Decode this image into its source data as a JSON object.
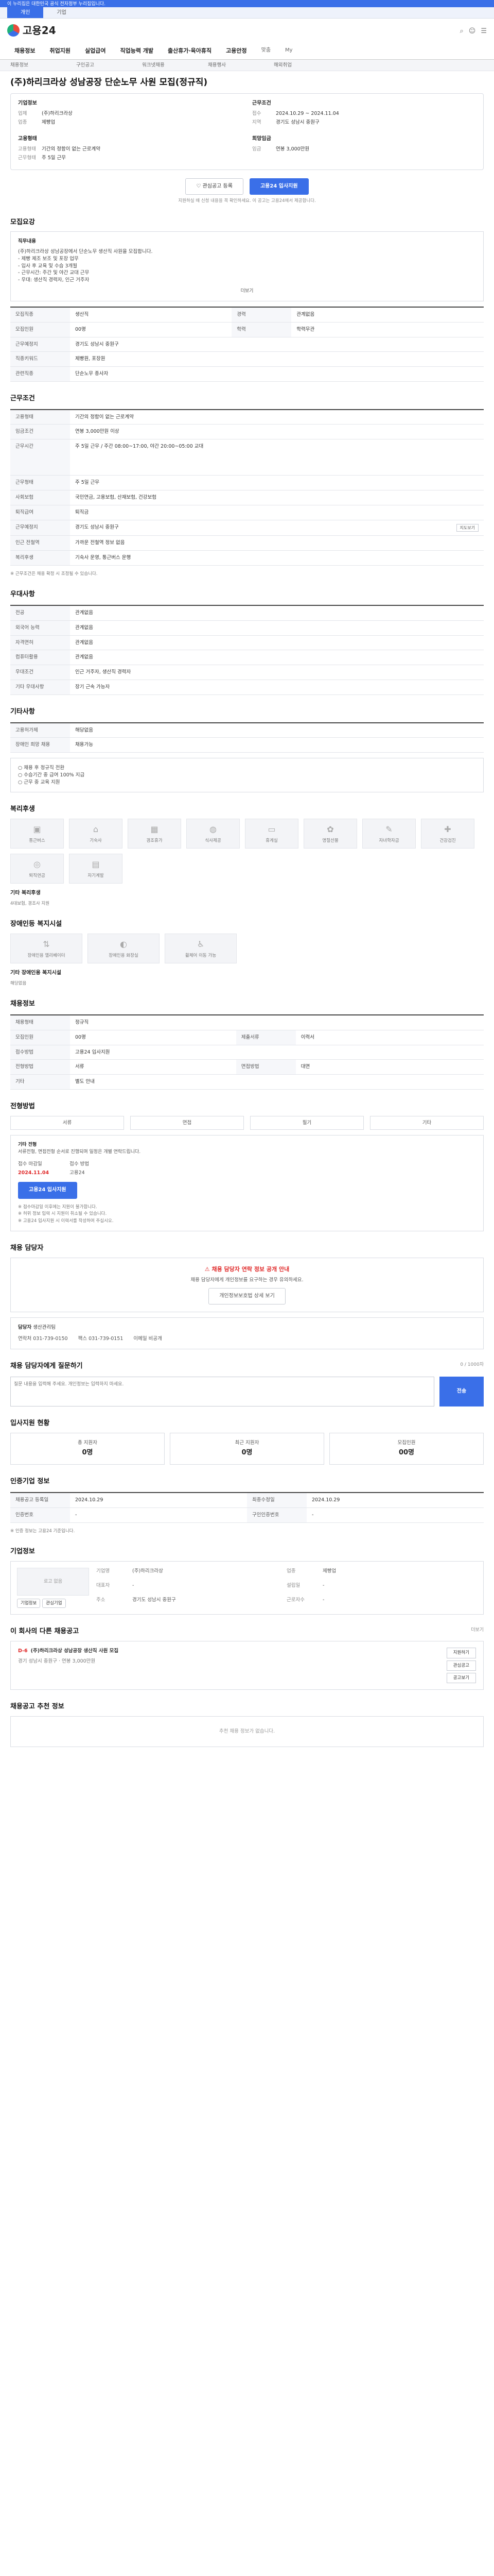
{
  "top": {
    "gov": "이 누리집은 대한민국 공식 전자정부 누리집입니다.",
    "tabs": [
      "개인",
      "기업"
    ]
  },
  "header": {
    "logo": "고용24"
  },
  "gnb": [
    "채용정보",
    "취업지원",
    "실업급여",
    "직업능력 개발",
    "출산휴가·육아휴직",
    "고용안정",
    "맞춤",
    "My"
  ],
  "subnav": [
    "채용정보",
    "구인공고",
    "워크넷채용",
    "채용행사",
    "해외취업"
  ],
  "job": {
    "title": "(주)하리크라상 성남공장 단순노무 사원 모집(정규직)",
    "company_label": "기업정보",
    "company": [
      [
        "업체",
        "(주)하리크라상"
      ],
      [
        "업종",
        "제빵업"
      ]
    ],
    "period_label": "근무조건",
    "period": [
      [
        "접수",
        "2024.10.29 ~ 2024.11.04"
      ],
      [
        "지역",
        "경기도 성남시 중원구"
      ]
    ],
    "emp_label": "고용형태",
    "emp": [
      [
        "고용형태",
        "기간의 정함이 없는 근로계약"
      ],
      [
        "근무형태",
        "주 5일 근무"
      ]
    ],
    "wage_label": "희망임금",
    "wage": [
      [
        "임금",
        "연봉 3,000만원"
      ]
    ],
    "btn_scrap": "관심공고 등록",
    "btn_apply": "고용24 입사지원",
    "note": "지원하실 때 신청 내용을 꼭 확인하세요. 이 공고는 고용24에서 제공합니다."
  },
  "s1": {
    "title": "모집요강",
    "desc_h": "직무내용",
    "desc": [
      "(주)하리크라상 성남공장에서 단순노무 생산직 사원을 모집합니다.",
      "- 제빵 제조 보조 및 포장 업무",
      "- 입사 후 교육 및 수습 3개월",
      "- 근무시간: 주간 및 야간 교대 근무",
      "- 우대: 생산직 경력자, 인근 거주자"
    ],
    "more": "더보기",
    "rows": [
      [
        "모집직종",
        "생산직",
        "경력",
        "관계없음"
      ],
      [
        "모집인원",
        "00명",
        "학력",
        "학력무관"
      ],
      [
        "근무예정지",
        "경기도 성남시 중원구",
        "",
        ""
      ],
      [
        "직종키워드",
        "제빵원, 포장원",
        "",
        ""
      ],
      [
        "관련직종",
        "단순노무 종사자",
        "",
        ""
      ]
    ]
  },
  "s2": {
    "title": "근무조건",
    "rows": [
      [
        "고용형태",
        "기간의 정함이 없는 근로계약"
      ],
      [
        "임금조건",
        "연봉 3,000만원 이상"
      ],
      [
        "근무시간",
        "주 5일 근무 / 주간 08:00~17:00, 야간 20:00~05:00 교대"
      ],
      [
        "근무형태",
        "주 5일 근무"
      ],
      [
        "사회보험",
        "국민연금, 고용보험, 산재보험, 건강보험"
      ],
      [
        "퇴직급여",
        "퇴직금"
      ],
      [
        "근무예정지",
        "경기도 성남시 중원구"
      ],
      [
        "인근 전철역",
        "가까운 전철역 정보 없음"
      ],
      [
        "복리후생",
        "기숙사 운영, 통근버스 운행"
      ]
    ],
    "map_btn": "지도보기",
    "note": "※ 근무조건은 채용 확정 시 조정될 수 있습니다."
  },
  "s3": {
    "title": "우대사항",
    "rows": [
      [
        "전공",
        "관계없음"
      ],
      [
        "외국어 능력",
        "관계없음"
      ],
      [
        "자격면허",
        "관계없음"
      ],
      [
        "컴퓨터활용",
        "관계없음"
      ],
      [
        "우대조건",
        "인근 거주자, 생산직 경력자"
      ],
      [
        "기타 우대사항",
        "장기 근속 가능자"
      ]
    ]
  },
  "s4": {
    "title": "기타사항",
    "rows": [
      [
        "고용허가제",
        "해당없음"
      ],
      [
        "장애인 희망 채용",
        "채용가능"
      ]
    ],
    "extra": [
      "○ 채용 후 정규직 전환",
      "○ 수습기간 중 급여 100% 지급",
      "○ 근무 중 교육 지원"
    ]
  },
  "s5": {
    "title": "복리후생",
    "items": [
      "통근버스",
      "기숙사",
      "경조휴가",
      "식사제공",
      "휴게실",
      "명절선물",
      "자녀학자금",
      "건강검진",
      "퇴직연금",
      "자기계발"
    ],
    "other_h": "기타 복리후생",
    "other": "4대보험, 경조사 지원"
  },
  "s6": {
    "title": "장애인등 복지시설",
    "items": [
      "장애인용 엘리베이터",
      "장애인용 화장실",
      "휠체어 이동 가능"
    ],
    "other_h": "기타 장애인용 복지시설",
    "other": "해당없음"
  },
  "s7": {
    "title": "채용정보",
    "rows": [
      [
        "채용형태",
        "정규직",
        "",
        ""
      ],
      [
        "모집인원",
        "00명",
        "제출서류",
        "이력서"
      ],
      [
        "접수방법",
        "고용24 입사지원",
        "",
        ""
      ],
      [
        "전형방법",
        "서류",
        "면접방법",
        "대면"
      ],
      [
        "기타",
        "별도 안내",
        "",
        ""
      ]
    ]
  },
  "s8": {
    "title": "전형방법",
    "methods": [
      "서류",
      "면접",
      "필기",
      "기타"
    ],
    "info_h": "기타 전형",
    "info": "서류전형, 면접전형 순서로 진행되며 일정은 개별 연락드립니다.",
    "app_h": "접수 마감일",
    "app_date": "2024.11.04",
    "reg_h": "접수 방법",
    "reg": "고용24",
    "btn": "고용24 입사지원",
    "bul": [
      "※ 접수마감일 이후에는 지원이 불가합니다.",
      "※ 허위 정보 입력 시 지원이 취소될 수 있습니다.",
      "※ 고용24 입사지원 시 이력서를 작성하여 주십시오."
    ]
  },
  "s9": {
    "title": "채용 담당자",
    "warn_t": "채용 담당자 연락 정보 공개 안내",
    "warn": "채용 담당자에게 개인정보를 요구하는 경우 유의하세요.",
    "btn": "개인정보보호법 상세 보기",
    "name_h": "담당자",
    "name": "생산관리팀",
    "tel_h": "연락처",
    "tel": "031-739-0150",
    "fax_h": "팩스",
    "fax": "031-739-0151",
    "email_h": "이메일",
    "email": "비공개"
  },
  "s10": {
    "title": "채용 담당자에게 질문하기",
    "ph": "질문 내용을 입력해 주세요. 개인정보는 입력하지 마세요.",
    "send": "전송",
    "count": "0 / 1000자"
  },
  "s11": {
    "title": "입사지원 현황",
    "items": [
      [
        "총 지원자",
        "0명"
      ],
      [
        "최근 지원자",
        "0명"
      ],
      [
        "모집인원",
        "00명"
      ]
    ]
  },
  "s12": {
    "title": "인증기업 정보",
    "rows": [
      [
        "채용공고 등록일",
        "2024.10.29",
        "최종수정일",
        "2024.10.29"
      ],
      [
        "인증번호",
        "-",
        "구인인증번호",
        "-"
      ]
    ],
    "note": "※ 인증 정보는 고용24 기준입니다."
  },
  "s13": {
    "title": "기업정보",
    "logo": "로고 없음",
    "rows": [
      [
        "기업명",
        "(주)하리크라상",
        "업종",
        "제빵업"
      ],
      [
        "대표자",
        "-",
        "설립일",
        "-"
      ],
      [
        "주소",
        "경기도 성남시 중원구",
        "근로자수",
        "-"
      ]
    ],
    "btn1": "기업정보",
    "btn2": "관심기업"
  },
  "s14": {
    "title": "이 회사의 다른 채용공고",
    "more": "더보기",
    "dday": "D-6",
    "job_title": "(주)하리크라상 성남공장 생산직 사원 모집",
    "job_info": "경기 성남시 중원구 · 연봉 3,000만원",
    "side": [
      "지원하기",
      "관심공고",
      "공고보기"
    ]
  },
  "s15": {
    "title": "채용공고 추천 정보",
    "empty": "추천 채용 정보가 없습니다."
  }
}
